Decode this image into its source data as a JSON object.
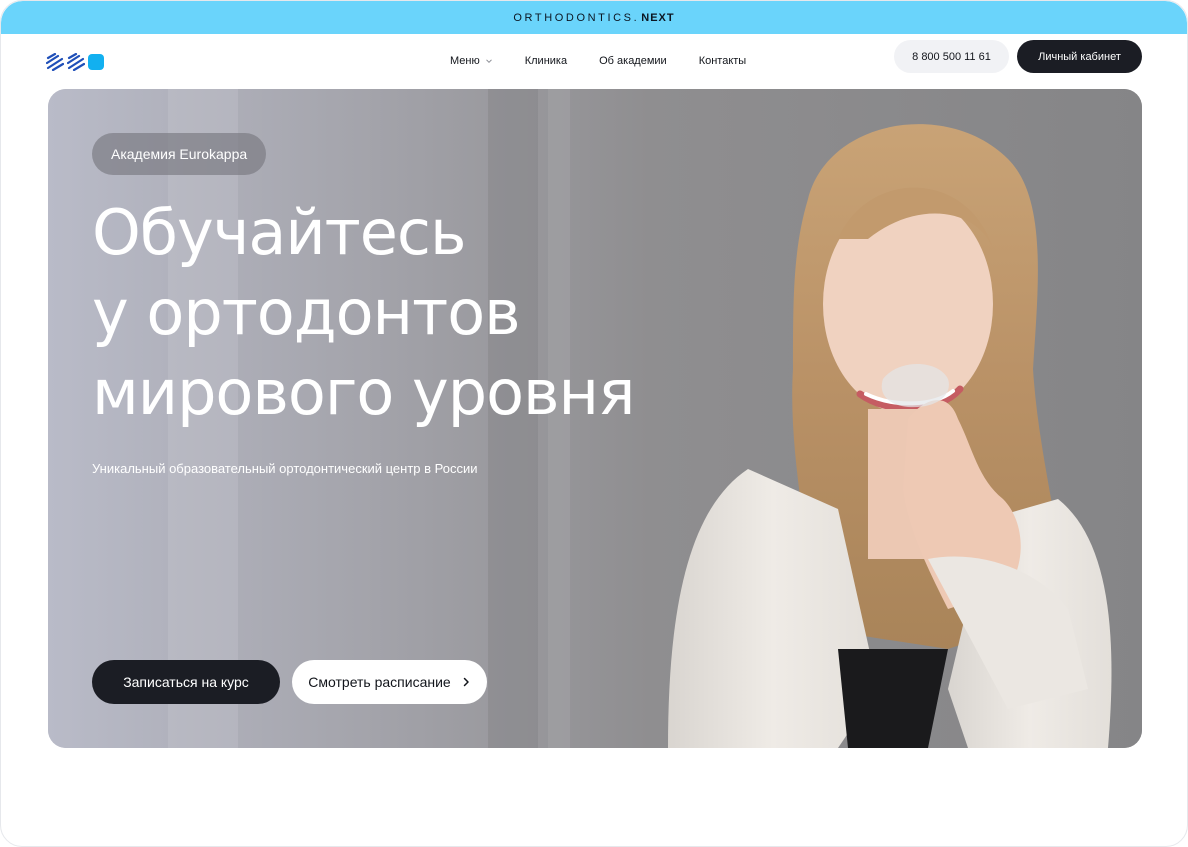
{
  "promo_bar": {
    "brand": "ORTHODONTICS.",
    "brand_suffix": "NEXT",
    "background": "#6ad4fb"
  },
  "header": {
    "logo_icon": "academy-logo-icon",
    "nav": [
      {
        "label": "Меню",
        "has_dropdown": true
      },
      {
        "label": "Клиника"
      },
      {
        "label": "Об академии"
      },
      {
        "label": "Контакты"
      }
    ],
    "phone": "8 800 500 11 61",
    "account_button": "Личный кабинет"
  },
  "hero": {
    "badge": "Академия Eurokappa",
    "title_lines": [
      "Обучайтесь",
      "у ортодонтов",
      "мирового уровня"
    ],
    "subtitle": "Уникальный образовательный ортодонтический центр в России",
    "primary_button": "Записаться на курс",
    "secondary_button": "Смотреть расписание",
    "image": "woman-holding-clear-aligner-photo"
  },
  "colors": {
    "accent": "#12b0f0",
    "dark": "#1b1d24",
    "promo": "#6ad4fb"
  }
}
